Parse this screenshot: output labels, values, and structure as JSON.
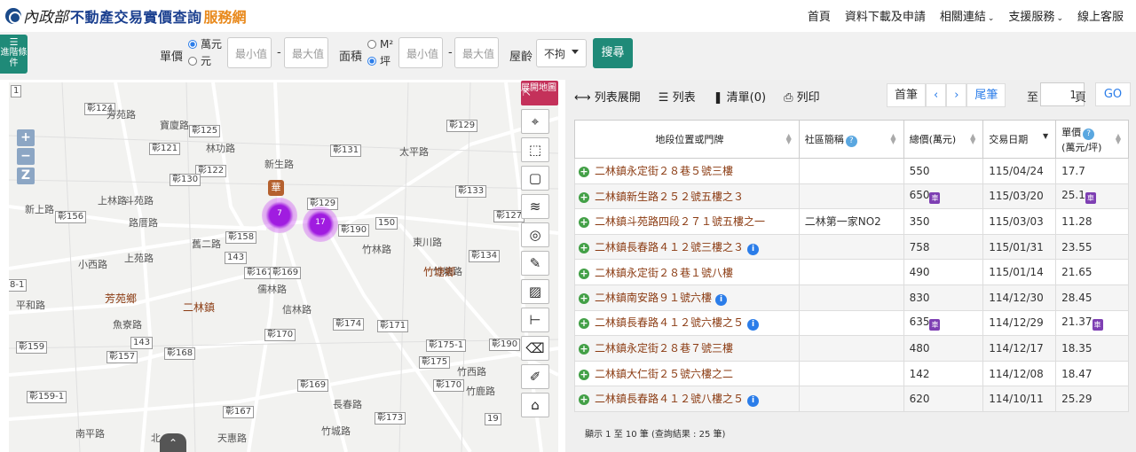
{
  "header": {
    "logo_ministry": "內政部",
    "logo_main": "不動產交易實價查詢",
    "logo_accent": "服務網",
    "nav": [
      {
        "label": "首頁",
        "dropdown": false
      },
      {
        "label": "資料下載及申請",
        "dropdown": false
      },
      {
        "label": "相關連結",
        "dropdown": true
      },
      {
        "label": "支援服務",
        "dropdown": true
      },
      {
        "label": "線上客服",
        "dropdown": false
      }
    ]
  },
  "filters": {
    "advanced_label": "進階條件",
    "unit_price_label": "單價",
    "unit_price_options": [
      "萬元",
      "元"
    ],
    "area_label": "面積",
    "area_options": [
      "M²",
      "坪"
    ],
    "min_placeholder": "最小值",
    "max_placeholder": "最大值",
    "dash": "-",
    "age_label": "屋齡",
    "age_value": "不拘",
    "search_label": "搜尋"
  },
  "map": {
    "zoom_in": "+",
    "zoom_out": "−",
    "zoom_z": "Z",
    "expand_label": "展開地圖",
    "marker_label": "華",
    "clusters": [
      "7",
      "17"
    ],
    "road_labels": [
      "彰124",
      "彰125",
      "彰121",
      "彰129",
      "彰131",
      "彰133",
      "彰122",
      "彰130",
      "彰156",
      "彰158",
      "彰129",
      "彰190",
      "彰127",
      "150",
      "彰134",
      "143",
      "彰167",
      "彰169",
      "1",
      "8-1",
      "彰159",
      "彰157",
      "143",
      "彰168",
      "彰170",
      "彰174",
      "彰171",
      "彰175-1",
      "彰175",
      "彰190",
      "彰170",
      "彰169",
      "彰159-1",
      "彰167",
      "彰173",
      "19"
    ],
    "place_labels": [
      "芳苑路",
      "寶廈路",
      "林功路",
      "新生路",
      "太平路",
      "新上路",
      "斗苑路",
      "上林路",
      "路厝路",
      "舊二路",
      "東川路",
      "竹林路",
      "小西路",
      "上苑路",
      "儒林路",
      "信林路",
      "竹塘路",
      "平和路",
      "魚寮路",
      "竹西路",
      "竹鹿路",
      "長春路",
      "南平路",
      "天惠路",
      "竹城路",
      "北"
    ],
    "towns": [
      "芳苑鄉",
      "二林鎮",
      "竹塘鄉"
    ]
  },
  "panel": {
    "toolbar": {
      "expand": "列表展開",
      "list": "列表",
      "bookmark": "清單(0)",
      "print": "列印"
    },
    "pager": {
      "first": "首筆",
      "prev": "‹",
      "next": "›",
      "last": "尾筆",
      "to": "至",
      "page": "1",
      "page_suffix": "頁",
      "go": "GO"
    },
    "columns": [
      "地段位置或門牌",
      "社區簡稱",
      "總價(萬元)",
      "交易日期",
      "單價\n(萬元/坪)"
    ],
    "rows": [
      {
        "address": "二林鎮永定街２８巷５號三樓",
        "community": "",
        "total": "550",
        "total_car": false,
        "date": "115/04/24",
        "unit": "17.7",
        "unit_car": false,
        "info": false
      },
      {
        "address": "二林鎮新生路２５２號五樓之３",
        "community": "",
        "total": "650",
        "total_car": true,
        "date": "115/03/20",
        "unit": "25.1",
        "unit_car": true,
        "info": false
      },
      {
        "address": "二林鎮斗苑路四段２７１號五樓之一",
        "community": "二林第一家NO2",
        "total": "350",
        "total_car": false,
        "date": "115/03/03",
        "unit": "11.28",
        "unit_car": false,
        "info": false
      },
      {
        "address": "二林鎮長春路４１２號三樓之３",
        "community": "",
        "total": "758",
        "total_car": false,
        "date": "115/01/31",
        "unit": "23.55",
        "unit_car": false,
        "info": true
      },
      {
        "address": "二林鎮永定街２８巷１號八樓",
        "community": "",
        "total": "490",
        "total_car": false,
        "date": "115/01/14",
        "unit": "21.65",
        "unit_car": false,
        "info": false
      },
      {
        "address": "二林鎮南安路９１號六樓",
        "community": "",
        "total": "830",
        "total_car": false,
        "date": "114/12/30",
        "unit": "28.45",
        "unit_car": false,
        "info": true
      },
      {
        "address": "二林鎮長春路４１２號六樓之５",
        "community": "",
        "total": "635",
        "total_car": true,
        "date": "114/12/29",
        "unit": "21.37",
        "unit_car": true,
        "info": true
      },
      {
        "address": "二林鎮永定街２８巷７號三樓",
        "community": "",
        "total": "480",
        "total_car": false,
        "date": "114/12/17",
        "unit": "18.35",
        "unit_car": false,
        "info": false
      },
      {
        "address": "二林鎮大仁街２５號六樓之二",
        "community": "",
        "total": "142",
        "total_car": false,
        "date": "114/12/08",
        "unit": "18.47",
        "unit_car": false,
        "info": false
      },
      {
        "address": "二林鎮長春路４１２號八樓之５",
        "community": "",
        "total": "620",
        "total_car": false,
        "date": "114/10/11",
        "unit": "25.29",
        "unit_car": false,
        "info": true
      }
    ],
    "car_label": "車",
    "footer": "顯示 1 至 10 筆 (查詢結果 : 25 筆)"
  }
}
